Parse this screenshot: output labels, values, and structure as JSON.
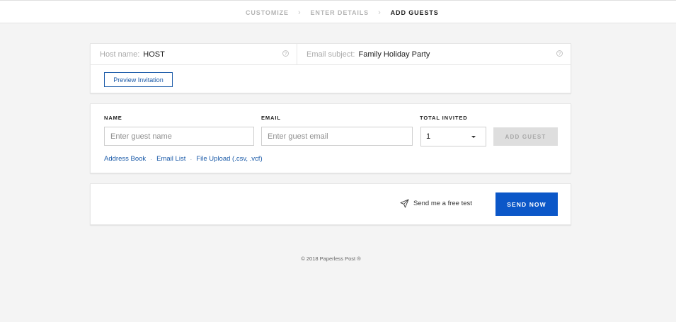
{
  "steps": [
    {
      "label": "CUSTOMIZE",
      "active": false
    },
    {
      "label": "ENTER DETAILS",
      "active": false
    },
    {
      "label": "ADD GUESTS",
      "active": true
    }
  ],
  "step_separator": "›",
  "host": {
    "host_label": "Host name:",
    "host_value": "HOST",
    "subject_label": "Email subject:",
    "subject_value": "Family Holiday Party",
    "help_glyph": "?",
    "preview_label": "Preview Invitation"
  },
  "guests": {
    "name_label": "NAME",
    "email_label": "EMAIL",
    "total_label": "TOTAL INVITED",
    "name_placeholder": "Enter guest name",
    "email_placeholder": "Enter guest email",
    "name_value": "",
    "email_value": "",
    "total_selected": "1",
    "add_label": "ADD GUEST",
    "links": [
      "Address Book",
      "Email List",
      "File Upload (.csv, .vcf)"
    ],
    "link_separator": "·"
  },
  "send": {
    "test_label": "Send me a free test",
    "test_icon": "paper-plane-icon",
    "send_label": "SEND NOW"
  },
  "footer": {
    "copyright": "© 2018 Paperless Post ®"
  },
  "colors": {
    "accent": "#0b57c8",
    "link": "#1a5aa8",
    "disabled": "#dedede",
    "background": "#f4f4f4"
  }
}
